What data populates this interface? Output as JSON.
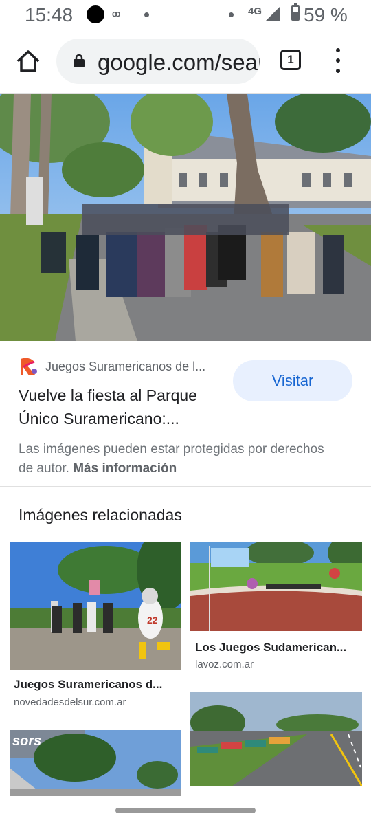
{
  "status_bar": {
    "time": "15:48",
    "carrier_logo": "ꝏ",
    "network": "4G",
    "battery_text": "59 %",
    "battery_level": 0.59
  },
  "browser": {
    "url": "google.com/search",
    "tab_count": "1"
  },
  "result": {
    "source_name": "Juegos Suramericanos de l...",
    "visit_label": "Visitar",
    "title_line1": "Vuelve la fiesta al Parque",
    "title_line2": "Único Suramericano:...",
    "copyright_text": "Las imágenes pueden estar protegidas por derechos de autor.",
    "more_info": "Más información"
  },
  "related": {
    "heading": "Imágenes relacionadas",
    "items": [
      {
        "title": "Juegos Suramericanos d...",
        "domain": "novedadesdelsur.com.ar"
      },
      {
        "title": "Los Juegos Sudamerican...",
        "domain": "lavoz.com.ar"
      },
      {
        "title": "",
        "domain": ""
      },
      {
        "title": "",
        "domain": ""
      }
    ],
    "banner_text": "sors"
  },
  "colors": {
    "accent": "#1967d2",
    "visit_bg": "#e8f0fe",
    "url_bg": "#f1f3f4"
  }
}
